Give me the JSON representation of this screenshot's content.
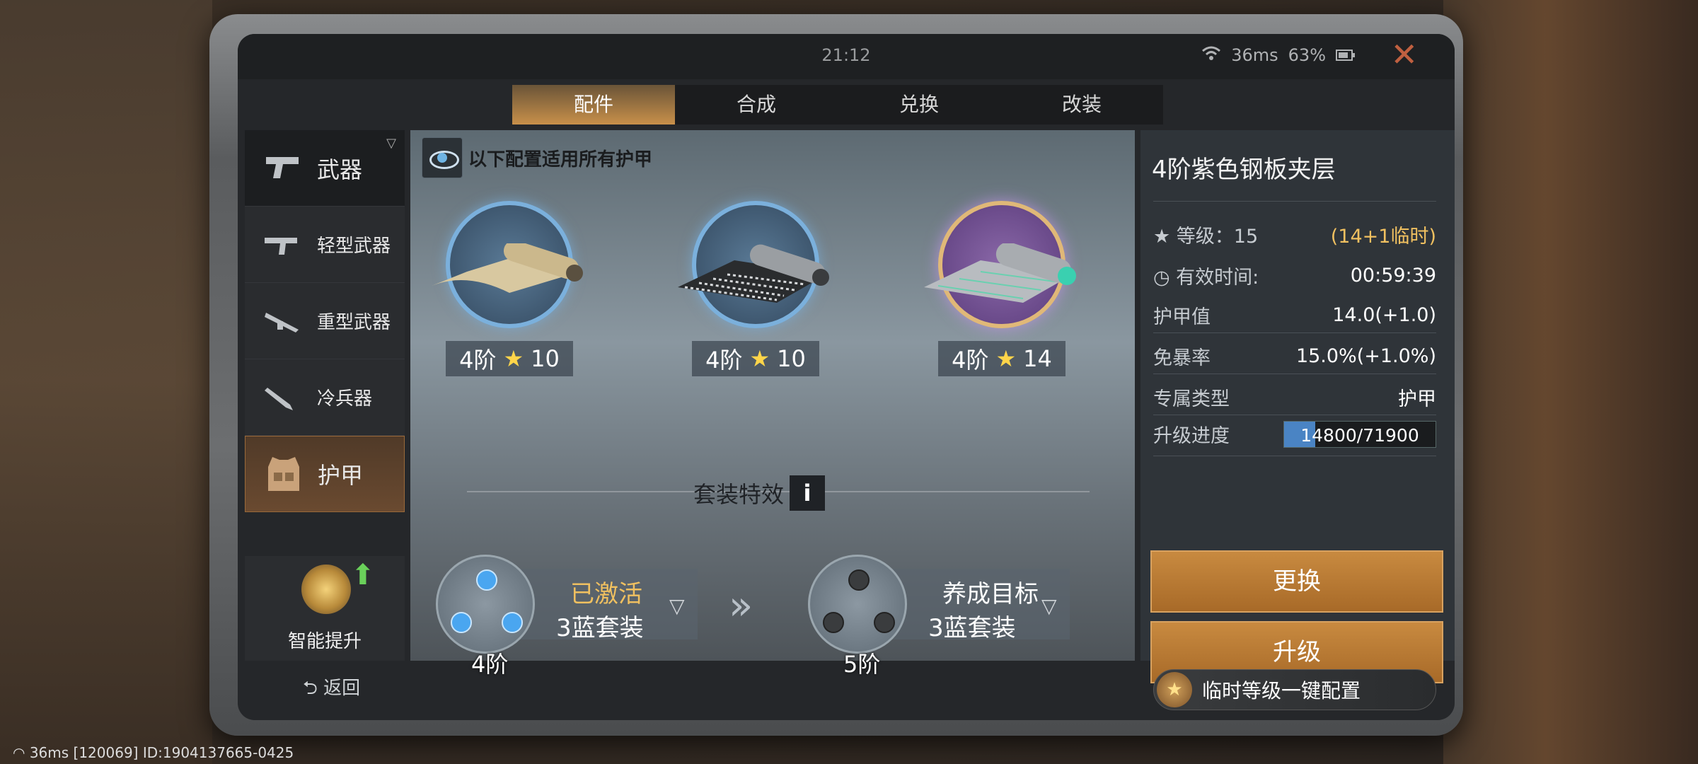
{
  "status": {
    "time": "21:12",
    "ping": "36ms",
    "battery": "63%"
  },
  "tabs": [
    {
      "label": "配件",
      "active": true
    },
    {
      "label": "合成"
    },
    {
      "label": "兑换"
    },
    {
      "label": "改装"
    }
  ],
  "sidebar": {
    "weapons": "武器",
    "light": "轻型武器",
    "heavy": "重型武器",
    "melee": "冷兵器",
    "armor": "护甲",
    "smart": "智能提升",
    "back": "返回"
  },
  "notice": "以下配置适用所有护甲",
  "items": [
    {
      "tier": "4阶",
      "stars": "10"
    },
    {
      "tier": "4阶",
      "stars": "10"
    },
    {
      "tier": "4阶",
      "stars": "14"
    }
  ],
  "set_title": "套装特效",
  "sets": [
    {
      "status": "已激活",
      "name": "3蓝套装",
      "tier": "4阶"
    },
    {
      "status": "养成目标",
      "name": "3蓝套装",
      "tier": "5阶"
    }
  ],
  "detail": {
    "title": "4阶紫色钢板夹层",
    "level_label": "等级：15",
    "level_bonus": "(14+1临时)",
    "time_label": "有效时间:",
    "time_value": "00:59:39",
    "armor_label": "护甲值",
    "armor_value": "14.0(+1.0)",
    "crit_label": "免暴率",
    "crit_value": "15.0%(+1.0%)",
    "type_label": "专属类型",
    "type_value": "护甲",
    "progress_label": "升级进度",
    "progress_text": "14800/71900",
    "progress_fraction": 0.206,
    "replace": "更换",
    "upgrade": "升级"
  },
  "quick_config": "临时等级一键配置",
  "osd": "36ms [120069] ID:1904137665-0425",
  "colors": {
    "accent": "#c88a40",
    "gold": "#f0c060",
    "blue": "#4aa6f0"
  }
}
